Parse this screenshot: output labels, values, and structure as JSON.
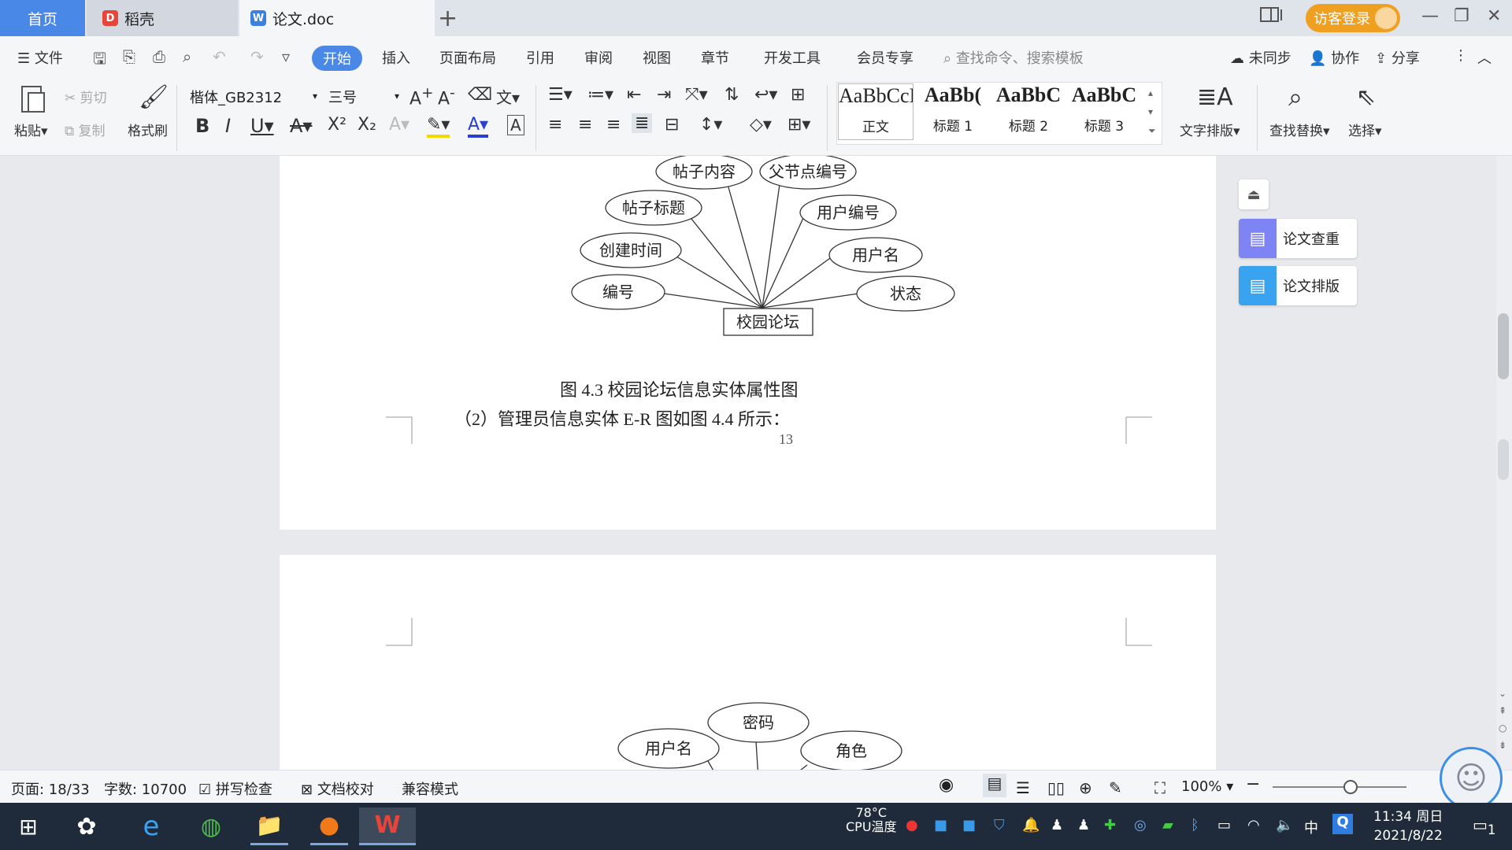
{
  "tabs": {
    "home": "首页",
    "daoke": "稻壳",
    "doc": "论文.doc",
    "login": "访客登录"
  },
  "menu": {
    "file": "文件",
    "items": [
      "开始",
      "插入",
      "页面布局",
      "引用",
      "审阅",
      "视图",
      "章节",
      "开发工具",
      "会员专享"
    ],
    "search_placeholder": "查找命令、搜索模板",
    "sync": "未同步",
    "collab": "协作",
    "share": "分享"
  },
  "ribbon": {
    "paste": "粘贴",
    "cut": "剪切",
    "copy": "复制",
    "format_painter": "格式刷",
    "font_name": "楷体_GB2312",
    "font_size": "三号",
    "styles": [
      {
        "preview": "AaBbCcI",
        "label": "正文"
      },
      {
        "preview": "AaBb(",
        "label": "标题 1"
      },
      {
        "preview": "AaBbC",
        "label": "标题 2"
      },
      {
        "preview": "AaBbC",
        "label": "标题 3"
      }
    ],
    "text_layout": "文字排版",
    "find_replace": "查找替换",
    "select": "选择"
  },
  "doc": {
    "diagram1": {
      "entity": "校园论坛",
      "attributes": [
        "帖子内容",
        "父节点编号",
        "帖子标题",
        "用户编号",
        "创建时间",
        "用户名",
        "编号",
        "状态"
      ]
    },
    "caption": "图 4.3  校园论坛信息实体属性图",
    "paragraph": "（2）管理员信息实体 E-R 图如图 4.4 所示：",
    "page_number": "13",
    "diagram2": {
      "attributes": [
        "密码",
        "用户名",
        "角色"
      ]
    }
  },
  "side_panel": {
    "check": "论文查重",
    "layout": "论文排版"
  },
  "status": {
    "page": "页面: 18/33",
    "words": "字数: 10700",
    "spell": "拼写检查",
    "proof": "文档校对",
    "compat": "兼容模式",
    "zoom": "100%"
  },
  "taskbar": {
    "temp": "78°C",
    "temp_label": "CPU温度",
    "ime": "中",
    "time": "11:34 周日",
    "date": "2021/8/22",
    "notif_count": "1"
  }
}
